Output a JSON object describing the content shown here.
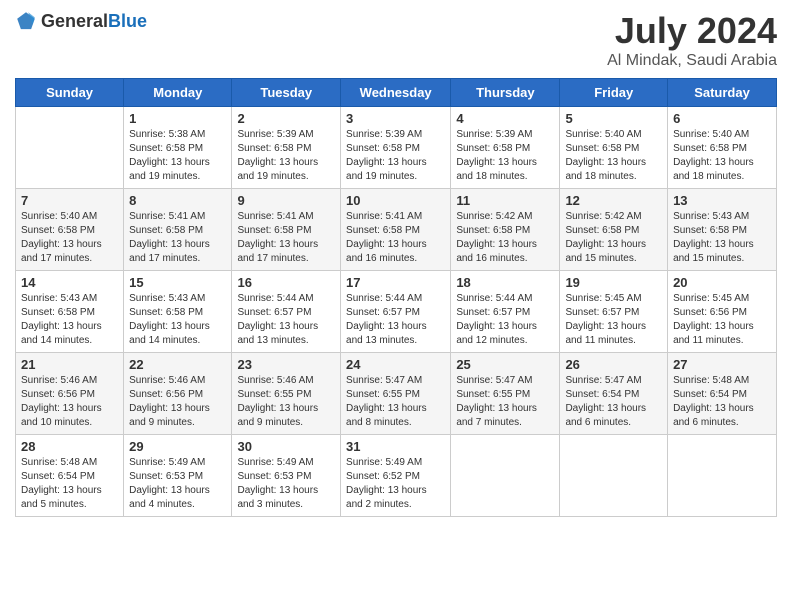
{
  "header": {
    "logo_general": "General",
    "logo_blue": "Blue",
    "month_title": "July 2024",
    "location": "Al Mindak, Saudi Arabia"
  },
  "days_of_week": [
    "Sunday",
    "Monday",
    "Tuesday",
    "Wednesday",
    "Thursday",
    "Friday",
    "Saturday"
  ],
  "weeks": [
    [
      {
        "day": "",
        "info": ""
      },
      {
        "day": "1",
        "info": "Sunrise: 5:38 AM\nSunset: 6:58 PM\nDaylight: 13 hours and 19 minutes."
      },
      {
        "day": "2",
        "info": "Sunrise: 5:39 AM\nSunset: 6:58 PM\nDaylight: 13 hours and 19 minutes."
      },
      {
        "day": "3",
        "info": "Sunrise: 5:39 AM\nSunset: 6:58 PM\nDaylight: 13 hours and 19 minutes."
      },
      {
        "day": "4",
        "info": "Sunrise: 5:39 AM\nSunset: 6:58 PM\nDaylight: 13 hours and 18 minutes."
      },
      {
        "day": "5",
        "info": "Sunrise: 5:40 AM\nSunset: 6:58 PM\nDaylight: 13 hours and 18 minutes."
      },
      {
        "day": "6",
        "info": "Sunrise: 5:40 AM\nSunset: 6:58 PM\nDaylight: 13 hours and 18 minutes."
      }
    ],
    [
      {
        "day": "7",
        "info": "Sunrise: 5:40 AM\nSunset: 6:58 PM\nDaylight: 13 hours and 17 minutes."
      },
      {
        "day": "8",
        "info": "Sunrise: 5:41 AM\nSunset: 6:58 PM\nDaylight: 13 hours and 17 minutes."
      },
      {
        "day": "9",
        "info": "Sunrise: 5:41 AM\nSunset: 6:58 PM\nDaylight: 13 hours and 17 minutes."
      },
      {
        "day": "10",
        "info": "Sunrise: 5:41 AM\nSunset: 6:58 PM\nDaylight: 13 hours and 16 minutes."
      },
      {
        "day": "11",
        "info": "Sunrise: 5:42 AM\nSunset: 6:58 PM\nDaylight: 13 hours and 16 minutes."
      },
      {
        "day": "12",
        "info": "Sunrise: 5:42 AM\nSunset: 6:58 PM\nDaylight: 13 hours and 15 minutes."
      },
      {
        "day": "13",
        "info": "Sunrise: 5:43 AM\nSunset: 6:58 PM\nDaylight: 13 hours and 15 minutes."
      }
    ],
    [
      {
        "day": "14",
        "info": "Sunrise: 5:43 AM\nSunset: 6:58 PM\nDaylight: 13 hours and 14 minutes."
      },
      {
        "day": "15",
        "info": "Sunrise: 5:43 AM\nSunset: 6:58 PM\nDaylight: 13 hours and 14 minutes."
      },
      {
        "day": "16",
        "info": "Sunrise: 5:44 AM\nSunset: 6:57 PM\nDaylight: 13 hours and 13 minutes."
      },
      {
        "day": "17",
        "info": "Sunrise: 5:44 AM\nSunset: 6:57 PM\nDaylight: 13 hours and 13 minutes."
      },
      {
        "day": "18",
        "info": "Sunrise: 5:44 AM\nSunset: 6:57 PM\nDaylight: 13 hours and 12 minutes."
      },
      {
        "day": "19",
        "info": "Sunrise: 5:45 AM\nSunset: 6:57 PM\nDaylight: 13 hours and 11 minutes."
      },
      {
        "day": "20",
        "info": "Sunrise: 5:45 AM\nSunset: 6:56 PM\nDaylight: 13 hours and 11 minutes."
      }
    ],
    [
      {
        "day": "21",
        "info": "Sunrise: 5:46 AM\nSunset: 6:56 PM\nDaylight: 13 hours and 10 minutes."
      },
      {
        "day": "22",
        "info": "Sunrise: 5:46 AM\nSunset: 6:56 PM\nDaylight: 13 hours and 9 minutes."
      },
      {
        "day": "23",
        "info": "Sunrise: 5:46 AM\nSunset: 6:55 PM\nDaylight: 13 hours and 9 minutes."
      },
      {
        "day": "24",
        "info": "Sunrise: 5:47 AM\nSunset: 6:55 PM\nDaylight: 13 hours and 8 minutes."
      },
      {
        "day": "25",
        "info": "Sunrise: 5:47 AM\nSunset: 6:55 PM\nDaylight: 13 hours and 7 minutes."
      },
      {
        "day": "26",
        "info": "Sunrise: 5:47 AM\nSunset: 6:54 PM\nDaylight: 13 hours and 6 minutes."
      },
      {
        "day": "27",
        "info": "Sunrise: 5:48 AM\nSunset: 6:54 PM\nDaylight: 13 hours and 6 minutes."
      }
    ],
    [
      {
        "day": "28",
        "info": "Sunrise: 5:48 AM\nSunset: 6:54 PM\nDaylight: 13 hours and 5 minutes."
      },
      {
        "day": "29",
        "info": "Sunrise: 5:49 AM\nSunset: 6:53 PM\nDaylight: 13 hours and 4 minutes."
      },
      {
        "day": "30",
        "info": "Sunrise: 5:49 AM\nSunset: 6:53 PM\nDaylight: 13 hours and 3 minutes."
      },
      {
        "day": "31",
        "info": "Sunrise: 5:49 AM\nSunset: 6:52 PM\nDaylight: 13 hours and 2 minutes."
      },
      {
        "day": "",
        "info": ""
      },
      {
        "day": "",
        "info": ""
      },
      {
        "day": "",
        "info": ""
      }
    ]
  ]
}
